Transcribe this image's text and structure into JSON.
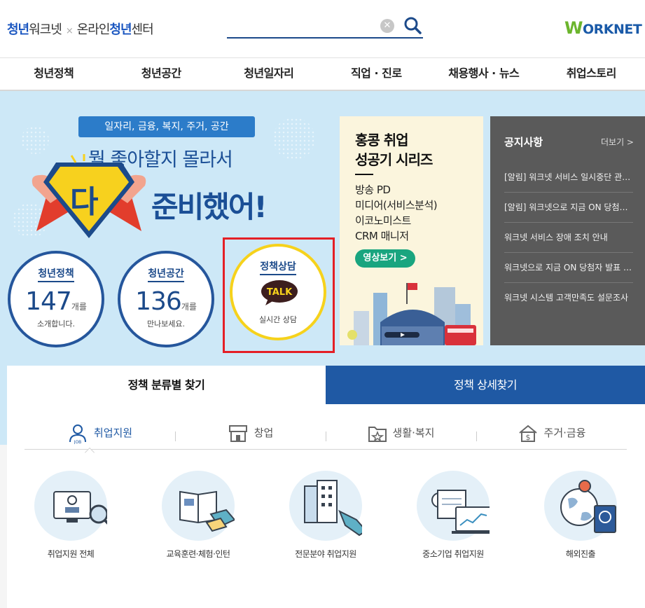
{
  "header": {
    "logo_part1": "청년",
    "logo_part2": "워크넷",
    "logo_separator": "×",
    "logo_part3": "온라인",
    "logo_part4": "청년",
    "logo_part5": "센터",
    "search": {
      "value": "",
      "placeholder": "",
      "clear_icon": "clear-icon",
      "search_icon": "search-icon"
    },
    "brand_logo_w": "W",
    "brand_logo_rest": "ORKNET"
  },
  "nav": {
    "items": [
      "청년정책",
      "청년공간",
      "청년일자리",
      "직업 · 진로",
      "채용행사 · 뉴스",
      "취업스토리"
    ]
  },
  "hero": {
    "ribbon": "일자리, 금융, 복지, 주거, 공간",
    "subtitle": "뭘 좋아할지 몰라서",
    "badge": "다",
    "title": "준비했어!",
    "circles": [
      {
        "title": "청년정책",
        "number": "147",
        "unit": "개를",
        "desc": "소개합니다."
      },
      {
        "title": "청년공간",
        "number": "136",
        "unit": "개를",
        "desc": "만나보세요."
      },
      {
        "title": "정책상담",
        "talk": "TALK",
        "desc": "실시간 상담"
      }
    ]
  },
  "banner": {
    "title_line1": "홍콩 취업",
    "title_line2": "성공기 시리즈",
    "list": [
      "방송 PD",
      "미디어(서비스분석)",
      "이코노미스트",
      "CRM 매니저"
    ],
    "button": "영상보기 >"
  },
  "notice": {
    "title": "공지사항",
    "more": "더보기 >",
    "items": [
      "[알림] 워크넷 서비스 일시중단 관련 안내",
      "[알림] 워크넷으로 지금 ON 당첨자 발표",
      "워크넷 서비스 장애 조치 안내",
      "워크넷으로 지금 ON 당첨자 발표 안내",
      "워크넷 시스템 고객만족도 설문조사"
    ]
  },
  "panel": {
    "tab_active": "정책 분류별 찾기",
    "tab_inactive": "정책 상세찾기",
    "categories": [
      "취업지원",
      "창업",
      "생활·복지",
      "주거·금융"
    ],
    "items": [
      "취업지원 전체",
      "교육훈련·체험·인턴",
      "전문분야 취업지원",
      "중소기업 취업지원",
      "해외진출"
    ]
  },
  "colors": {
    "primary": "#1f59a4",
    "hero_bg": "#cde8f7",
    "notice_bg": "#5a5a5a",
    "highlight": "#e41f26",
    "talk_yellow": "#f6d21c"
  }
}
